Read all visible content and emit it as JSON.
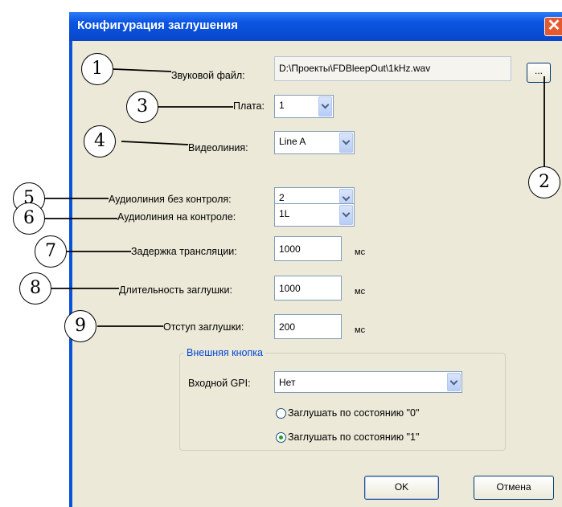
{
  "window": {
    "title": "Конфигурация заглушения",
    "close_glyph": "✕"
  },
  "fields": {
    "sound_file": {
      "label": "Звуковой файл:",
      "value": "D:\\Проекты\\FDBleepOut\\1kHz.wav",
      "browse": "..."
    },
    "board": {
      "label": "Плата:",
      "value": "1"
    },
    "video_line": {
      "label": "Видеолиния:",
      "value": "Line A"
    },
    "audio_uncontrolled": {
      "label": "Аудиолиния без контроля:",
      "value": "2"
    },
    "audio_controlled": {
      "label": "Аудиолиния на контроле:",
      "value": "1L"
    },
    "broadcast_delay": {
      "label": "Задержка трансляции:",
      "value": "1000",
      "unit": "мс"
    },
    "bleep_duration": {
      "label": "Длительность заглушки:",
      "value": "1000",
      "unit": "мс"
    },
    "bleep_offset": {
      "label": "Отступ заглушки:",
      "value": "200",
      "unit": "мс"
    }
  },
  "external": {
    "title": "Внешняя кнопка",
    "gpi_label": "Входной GPI:",
    "gpi_value": "Нет",
    "radio0": "Заглушать по состоянию \"0\"",
    "radio1": "Заглушать по состоянию \"1\"",
    "selected": 1
  },
  "buttons": {
    "ok": "OK",
    "cancel": "Отмена"
  },
  "callouts": [
    "1",
    "2",
    "3",
    "4",
    "5",
    "6",
    "7",
    "8",
    "9"
  ],
  "colors": {
    "titlebar": "#0b55e3",
    "dialog_bg": "#ece9d8",
    "group_title": "#0046d5",
    "close": "#e45a2e"
  }
}
